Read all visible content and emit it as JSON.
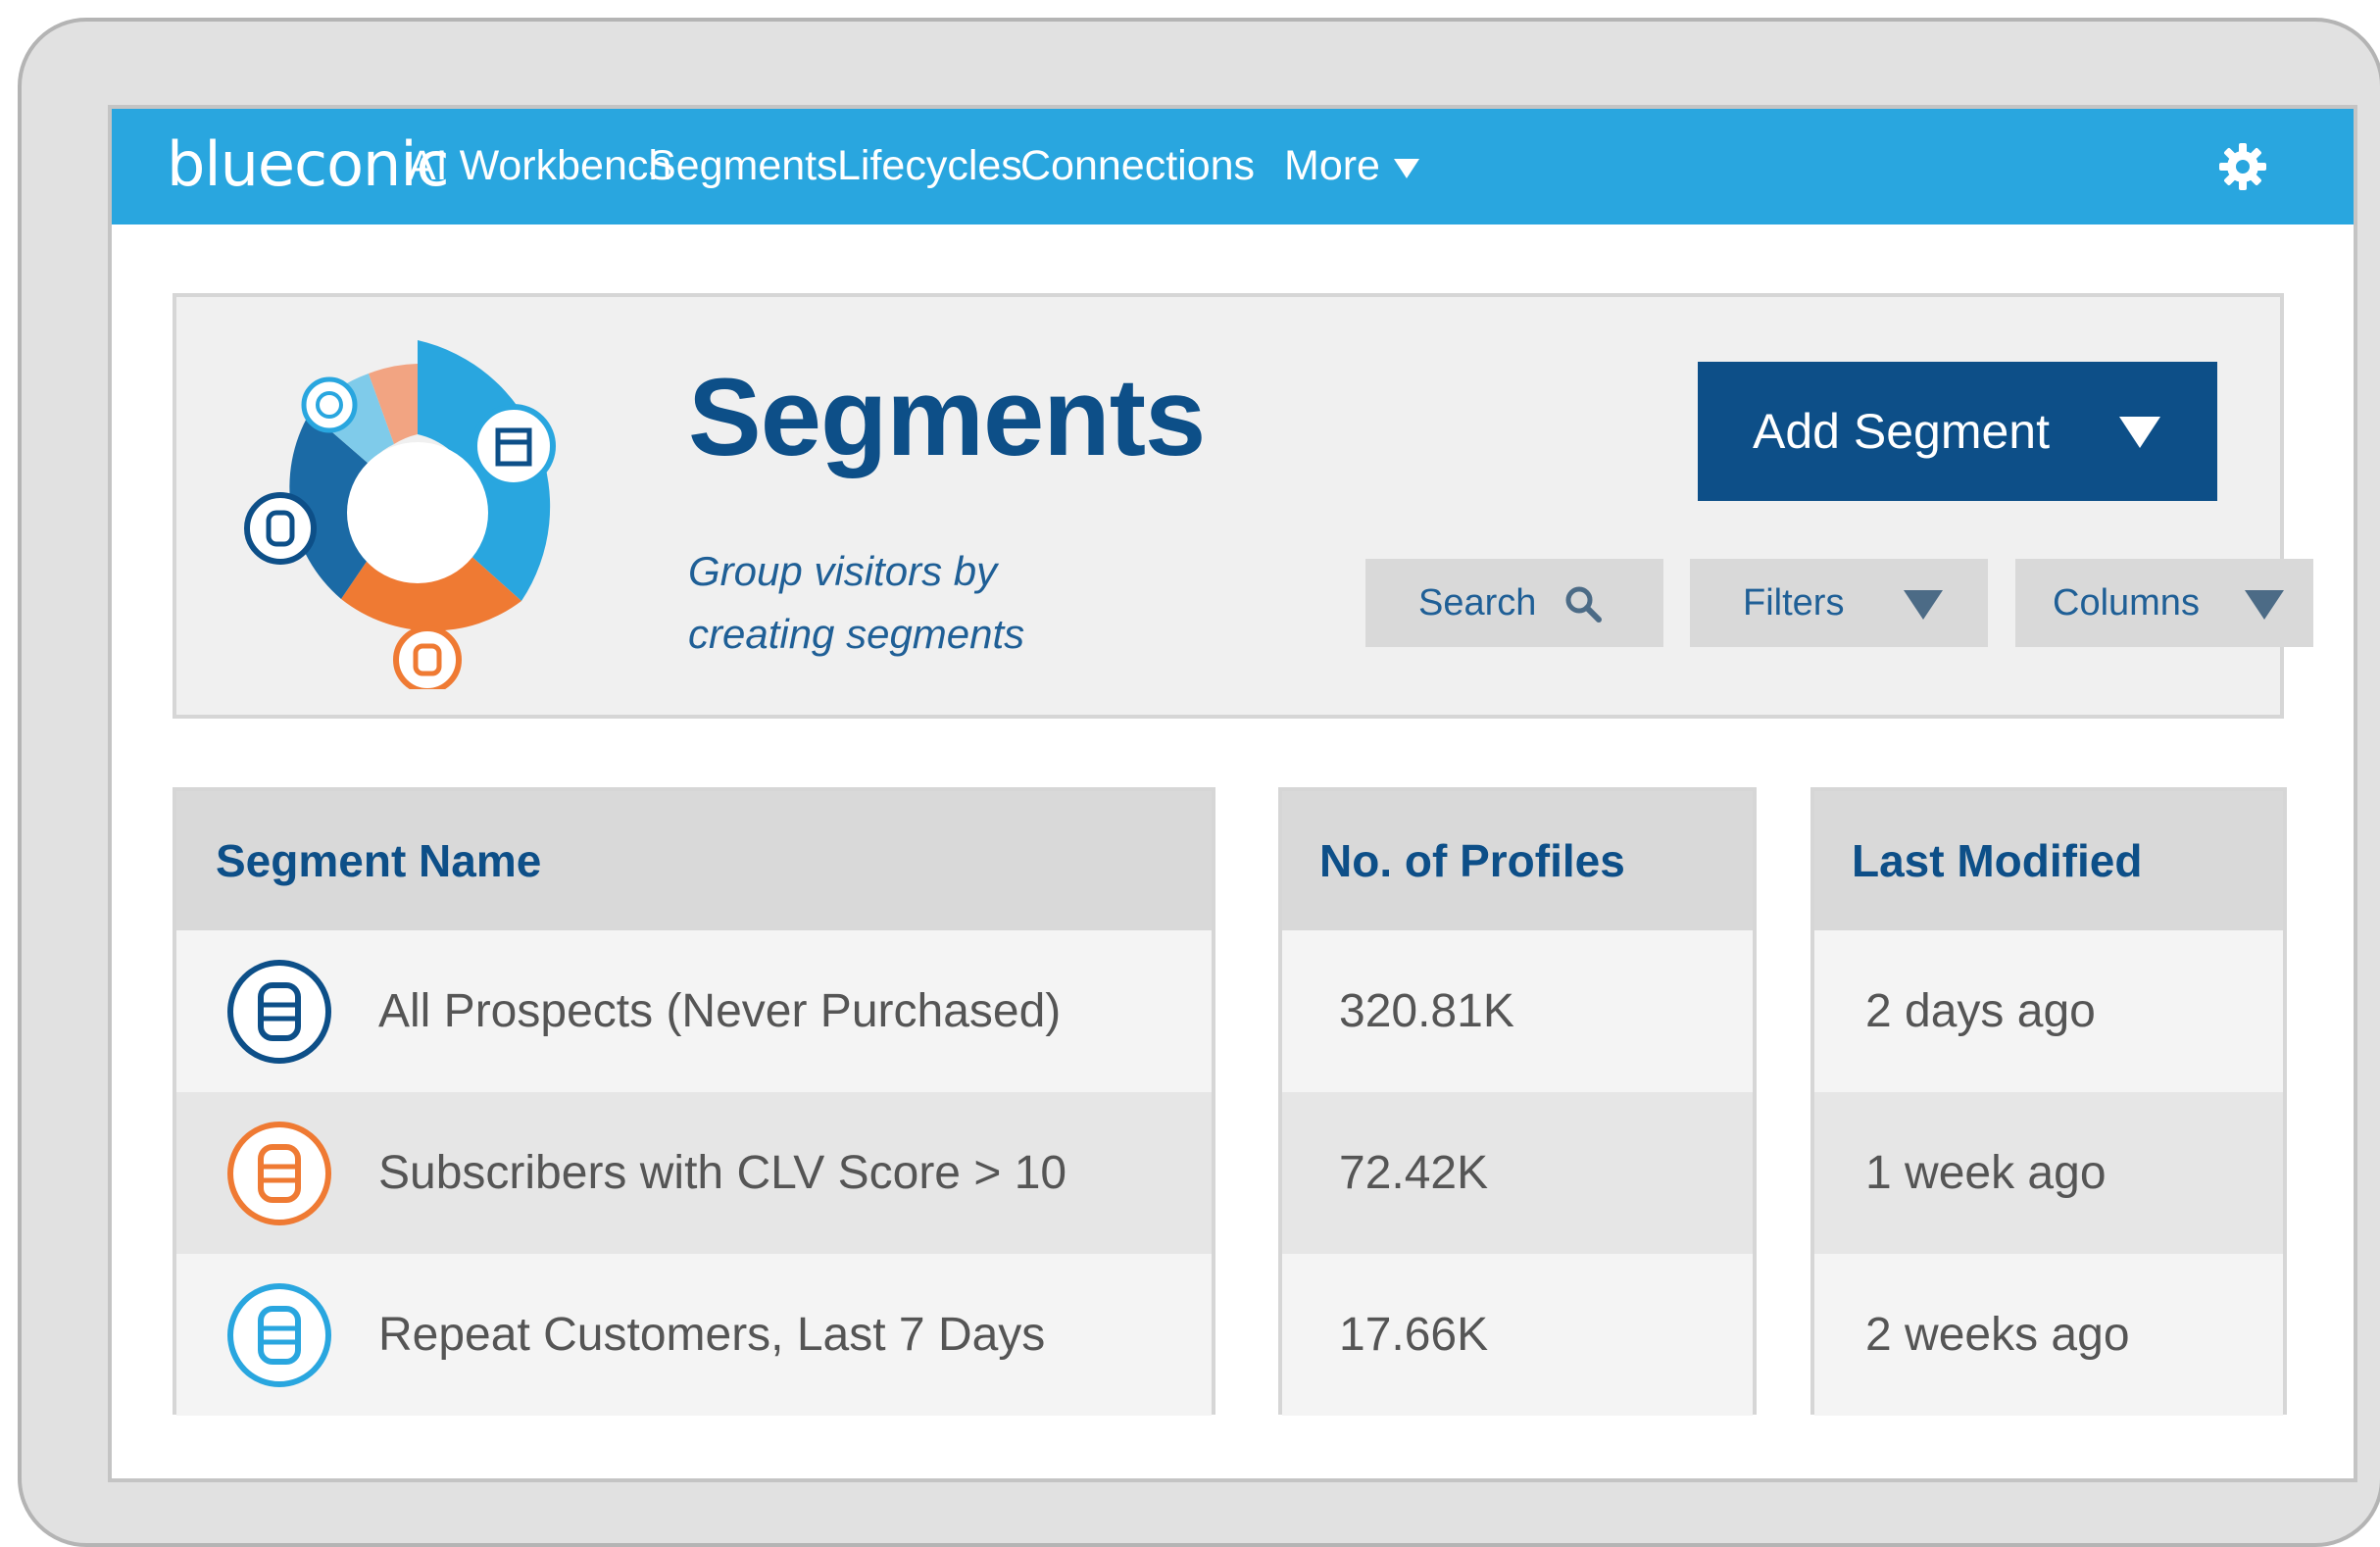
{
  "nav": {
    "logo": "blueconic",
    "items": [
      "AI Workbench",
      "Segments",
      "Lifecycles",
      "Connections"
    ],
    "more_label": "More",
    "settings_icon": "gear-icon"
  },
  "header": {
    "title": "Segments",
    "subtitle_line1": "Group visitors by",
    "subtitle_line2": "creating segments",
    "add_button_label": "Add Segment",
    "search_label": "Search",
    "filters_label": "Filters",
    "columns_label": "Columns"
  },
  "table": {
    "headers": {
      "name": "Segment Name",
      "profiles": "No. of Profiles",
      "modified": "Last Modified"
    },
    "rows": [
      {
        "name": "All Prospects (Never Purchased)",
        "profiles": "320.81K",
        "modified": "2 days ago",
        "icon_color": "#0d4f88"
      },
      {
        "name": "Subscribers with CLV Score > 10",
        "profiles": "72.42K",
        "modified": "1 week ago",
        "icon_color": "#ef7a33"
      },
      {
        "name": "Repeat Customers, Last 7 Days",
        "profiles": "17.66K",
        "modified": "2 weeks ago",
        "icon_color": "#29a6df"
      }
    ]
  },
  "colors": {
    "nav_blue": "#29a6df",
    "dark_blue": "#0d4f88",
    "orange": "#ef7a33",
    "light_orange": "#f2a482",
    "light_blue": "#7fcbea"
  }
}
